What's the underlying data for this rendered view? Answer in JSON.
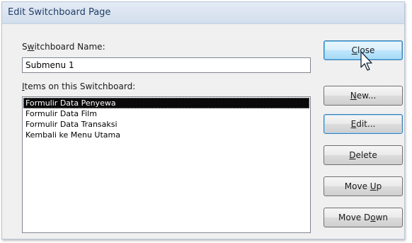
{
  "dialog": {
    "title": "Edit Switchboard Page"
  },
  "switchboard_name": {
    "label_pre": "S",
    "label_key": "w",
    "label_post": "itchboard Name:",
    "value": "Submenu 1"
  },
  "items": {
    "label_key": "I",
    "label_post": "tems on this Switchboard:",
    "list": [
      {
        "label": "Formulir Data Penyewa",
        "selected": true
      },
      {
        "label": "Formulir Data Film",
        "selected": false
      },
      {
        "label": "Formulir Data Transaksi",
        "selected": false
      },
      {
        "label": "Kembali ke Menu Utama",
        "selected": false
      }
    ]
  },
  "buttons": {
    "close": {
      "pre": "",
      "key": "C",
      "post": "lose"
    },
    "new": {
      "pre": "",
      "key": "N",
      "post": "ew..."
    },
    "edit": {
      "pre": "",
      "key": "E",
      "post": "dit..."
    },
    "delete": {
      "pre": "",
      "key": "D",
      "post": "elete"
    },
    "move_up": {
      "pre": "Move ",
      "key": "U",
      "post": "p"
    },
    "move_down": {
      "pre": "Move D",
      "key": "o",
      "post": "wn"
    }
  },
  "cursor": {
    "icon": "pointer-arrow-icon"
  },
  "colors": {
    "title_text": "#203d69",
    "selection_bg": "#0a0a0a",
    "default_button_border": "#3c7fb1"
  }
}
